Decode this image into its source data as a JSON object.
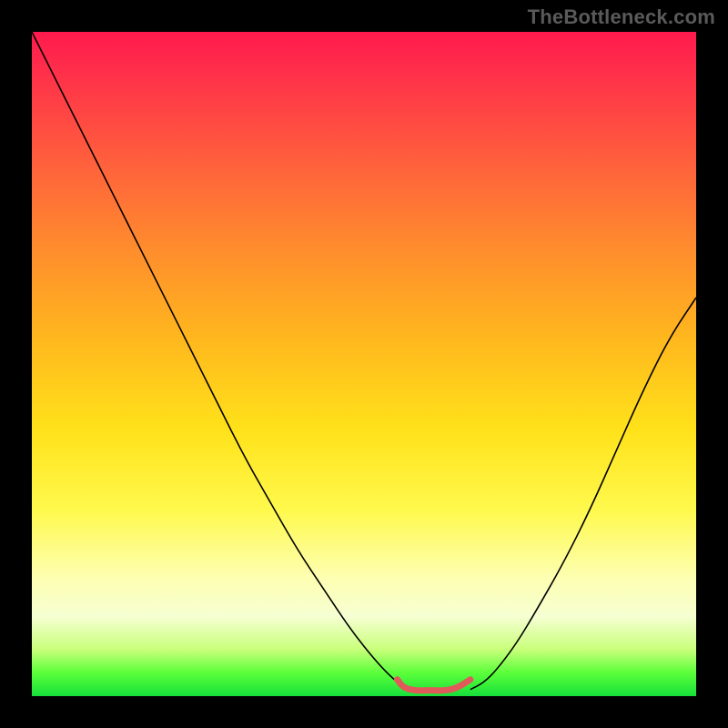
{
  "watermark": "TheBottleneck.com",
  "chart_data": {
    "type": "line",
    "title": "",
    "xlabel": "",
    "ylabel": "",
    "xlim": [
      0,
      100
    ],
    "ylim": [
      0,
      100
    ],
    "series": [
      {
        "name": "left-curve",
        "x": [
          0,
          4,
          8,
          12,
          16,
          20,
          24,
          28,
          32,
          36,
          40,
          44,
          48,
          52,
          55,
          57
        ],
        "values": [
          100,
          92,
          84,
          76,
          68,
          60,
          52,
          44,
          36,
          29,
          22,
          16,
          10,
          5,
          2,
          1
        ]
      },
      {
        "name": "right-curve",
        "x": [
          66,
          68,
          70,
          73,
          76,
          80,
          84,
          88,
          92,
          96,
          100
        ],
        "values": [
          1,
          2,
          4,
          8,
          13,
          20,
          28,
          37,
          46,
          54,
          60
        ]
      },
      {
        "name": "valley-highlight",
        "x": [
          55,
          56,
          58,
          60,
          62,
          64,
          66
        ],
        "values": [
          2.5,
          1.2,
          0.8,
          0.9,
          0.8,
          1.2,
          2.5
        ]
      }
    ],
    "colors": {
      "curve": "#000000",
      "valley_highlight": "#e15a5a",
      "background_gradient": [
        "#ff1a4d",
        "#ffb71e",
        "#fff94d",
        "#16e03a"
      ]
    }
  }
}
